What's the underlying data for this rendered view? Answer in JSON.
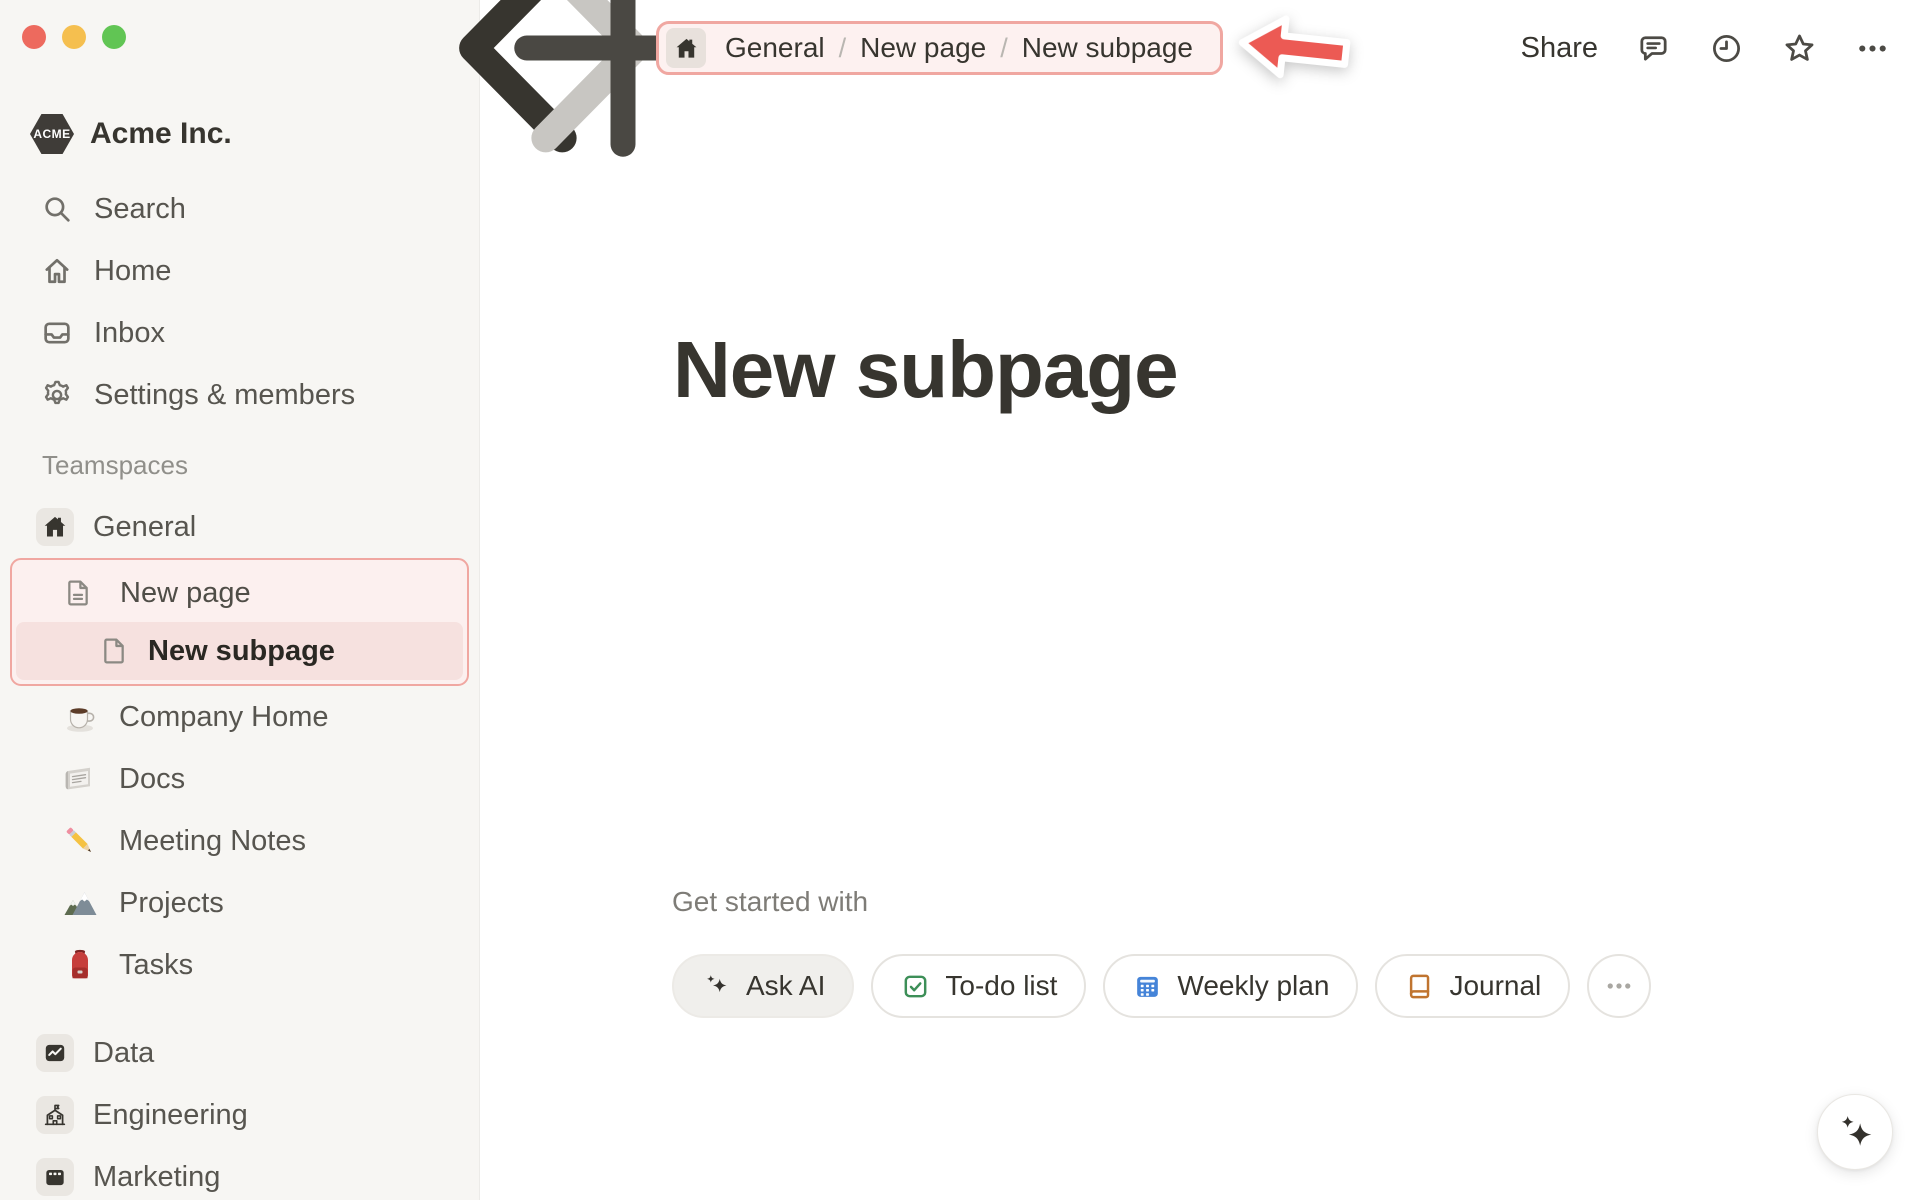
{
  "window": {
    "traffic_lights": [
      {
        "name": "close",
        "color": "#ed6a5e"
      },
      {
        "name": "minimize",
        "color": "#f5bf4f"
      },
      {
        "name": "zoom",
        "color": "#61c554"
      }
    ]
  },
  "sidebar": {
    "workspace": {
      "name": "Acme Inc.",
      "badge": "ACME"
    },
    "nav": [
      {
        "icon": "search",
        "label": "Search"
      },
      {
        "icon": "home-outline",
        "label": "Home"
      },
      {
        "icon": "inbox",
        "label": "Inbox"
      },
      {
        "icon": "gear",
        "label": "Settings & members"
      }
    ],
    "teamspaces_label": "Teamspaces",
    "teamspaces": [
      {
        "icon": "home-badge",
        "label": "General",
        "style": "badge"
      },
      {
        "icon": "page-text",
        "label": "New page",
        "indent": 1,
        "group": "highlight"
      },
      {
        "icon": "page-blank",
        "label": "New subpage",
        "indent": 2,
        "group": "highlight",
        "selected": true
      },
      {
        "icon": "coffee",
        "label": "Company Home",
        "indent": 1
      },
      {
        "icon": "newspaper",
        "label": "Docs",
        "indent": 1
      },
      {
        "icon": "pencil",
        "label": "Meeting Notes",
        "indent": 1
      },
      {
        "icon": "mountain",
        "label": "Projects",
        "indent": 1
      },
      {
        "icon": "backpack",
        "label": "Tasks",
        "indent": 1
      }
    ],
    "spaces": [
      {
        "icon": "data-badge",
        "label": "Data",
        "style": "badge"
      },
      {
        "icon": "school-badge",
        "label": "Engineering",
        "style": "badge"
      },
      {
        "icon": "billboard-badge",
        "label": "Marketing",
        "style": "badge"
      }
    ]
  },
  "topbar": {
    "breadcrumb": {
      "icon": "house-solid",
      "segments": [
        "General",
        "New page",
        "New subpage"
      ],
      "separator": "/"
    },
    "share_label": "Share",
    "action_icons": [
      "comment",
      "clock",
      "star",
      "dots"
    ]
  },
  "main": {
    "title": "New subpage",
    "get_started_label": "Get started with",
    "starters": [
      {
        "icon": "sparkle-ai",
        "label": "Ask AI",
        "variant": "filled"
      },
      {
        "icon": "todo",
        "label": "To-do list",
        "variant": "outline"
      },
      {
        "icon": "calendar",
        "label": "Weekly plan",
        "variant": "outline"
      },
      {
        "icon": "journal",
        "label": "Journal",
        "variant": "outline"
      },
      {
        "icon": "dots",
        "label": "",
        "variant": "circle"
      }
    ]
  },
  "annotations": {
    "arrow_color": "#ec5a54",
    "highlight_border": "#f0a7a1",
    "highlight_fill": "#fcf0ef",
    "selected_fill": "#f6e1df"
  },
  "floating": {
    "icon": "sparkles"
  }
}
